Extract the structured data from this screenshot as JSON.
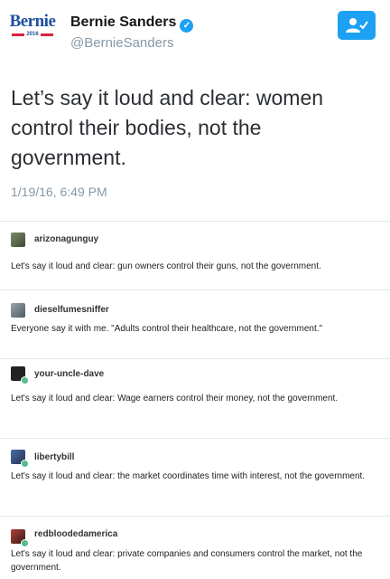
{
  "tweet": {
    "logo_text": "Bernie",
    "logo_year": "2016",
    "display_name": "Bernie Sanders",
    "handle": "@BernieSanders",
    "text": "Let’s say it loud and clear: women control their bodies, not the government.",
    "timestamp": "1/19/16, 6:49 PM"
  },
  "colors": {
    "twitter_blue": "#1da1f2",
    "muted_gray": "#8899a6",
    "reblog_green": "#56bc8a"
  },
  "replies": [
    {
      "username": "arizonagunguy",
      "text": "Let's say it loud and clear: gun owners control their guns, not the government."
    },
    {
      "username": "dieselfumesniffer",
      "text": "Everyone say it with me. \"Adults control their healthcare, not the government.\""
    },
    {
      "username": "your-uncle-dave",
      "text": "Let's say it loud and clear: Wage earners control their money, not the government."
    },
    {
      "username": "libertybill",
      "text": "Let's say it loud and clear: the market coordinates time with interest, not the government."
    },
    {
      "username": "redbloodedamerica",
      "text": "Let's say it loud and clear: private companies and consumers control the market, not the government."
    }
  ]
}
